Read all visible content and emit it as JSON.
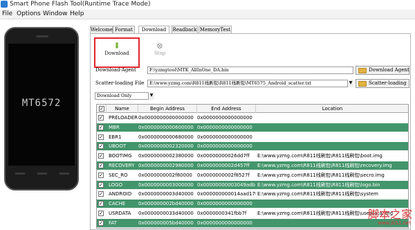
{
  "window": {
    "title": "Smart Phone Flash Tool(Runtime Trace Mode)"
  },
  "menu": [
    "File",
    "Options",
    "Window",
    "Help"
  ],
  "phone": {
    "model": "MT6572"
  },
  "tabs": [
    {
      "label": "Welcome"
    },
    {
      "label": "Format"
    },
    {
      "label": "Download"
    },
    {
      "label": "Readback"
    },
    {
      "label": "MemoryTest"
    }
  ],
  "active_tab": "Download",
  "toolbar": {
    "download_label": "Download",
    "stop_label": "Stop"
  },
  "download_agent": {
    "label": "Download-Agent",
    "value": "F:\\yzmgtool\\MTK_AllInOne_DA.bin",
    "button_label": "Download Agent"
  },
  "scatter": {
    "label": "Scatter-loading File",
    "value": "E:\\www.yzmg.com\\R811线刷包\\R811线刷包\\MT6575_Android_scatter.txt",
    "button_label": "Scatter-loading"
  },
  "mode_select": {
    "value": "Download Only"
  },
  "table": {
    "columns": [
      "",
      "Name",
      "Begin Address",
      "End Address",
      "Location"
    ],
    "rows": [
      {
        "checked": "✓",
        "name": "PRELOADER",
        "begin": "0x0000000000000000",
        "end": "0x0000000000000000",
        "location": ""
      },
      {
        "checked": "✓",
        "name": "MBR",
        "begin": "0x0000000000600000",
        "end": "0x0000000000000000",
        "location": ""
      },
      {
        "checked": "✓",
        "name": "EBR1",
        "begin": "0x0000000000680000",
        "end": "0x0000000000000000",
        "location": ""
      },
      {
        "checked": "✓",
        "name": "UBOOT",
        "begin": "0x0000000002320000",
        "end": "0x0000000000000000",
        "location": ""
      },
      {
        "checked": "✓",
        "name": "BOOTIMG",
        "begin": "0x0000000002380000",
        "end": "0x00000000026dd7ff",
        "location": "E:\\www.yzmg.com\\R811线刷包\\R811线刷包\\boot.img"
      },
      {
        "checked": "✓",
        "name": "RECOVERY",
        "begin": "0x0000000002980000",
        "end": "0x0000000002d457ff",
        "location": "E:\\www.yzmg.com\\R811线刷包\\R811线刷包\\recovery.img"
      },
      {
        "checked": "✓",
        "name": "SEC_RO",
        "begin": "0x0000000002f80000",
        "end": "0x0000000002f8527f",
        "location": "E:\\www.yzmg.com\\R811线刷包\\R811线刷包\\secro.img"
      },
      {
        "checked": "✓",
        "name": "LOGO",
        "begin": "0x0000000003000000",
        "end": "0x00000000003049adb",
        "location": "E:\\www.yzmg.com\\R811线刷包\\R811线刷包\\logo.bin"
      },
      {
        "checked": "✓",
        "name": "ANDROID",
        "begin": "0x0000000003d40000",
        "end": "0x000000000014aad17f",
        "location": "E:\\www.yzmg.com\\R811线刷包\\R811线刷包\\system"
      },
      {
        "checked": "✓",
        "name": "CACHE",
        "begin": "0x000000002bd40000",
        "end": "0x0000000000000000",
        "location": ""
      },
      {
        "checked": "✓",
        "name": "USRDATA",
        "begin": "0x0000000033d40000",
        "end": "0x0000000341fbb7f",
        "location": "E:\\www.yzmg.com\\R811线刷包\\R811线刷包\\userdata.img"
      },
      {
        "checked": "✓",
        "name": "FAT",
        "begin": "0x000000005bd40000",
        "end": "0x0000000000000000",
        "location": ""
      }
    ]
  },
  "watermark": {
    "main": "脚本之家",
    "sub": "www.jb51.net"
  },
  "colors": {
    "row_dark": "#43956b",
    "highlight": "#e3232c",
    "download_icon": "#7cb53a"
  }
}
